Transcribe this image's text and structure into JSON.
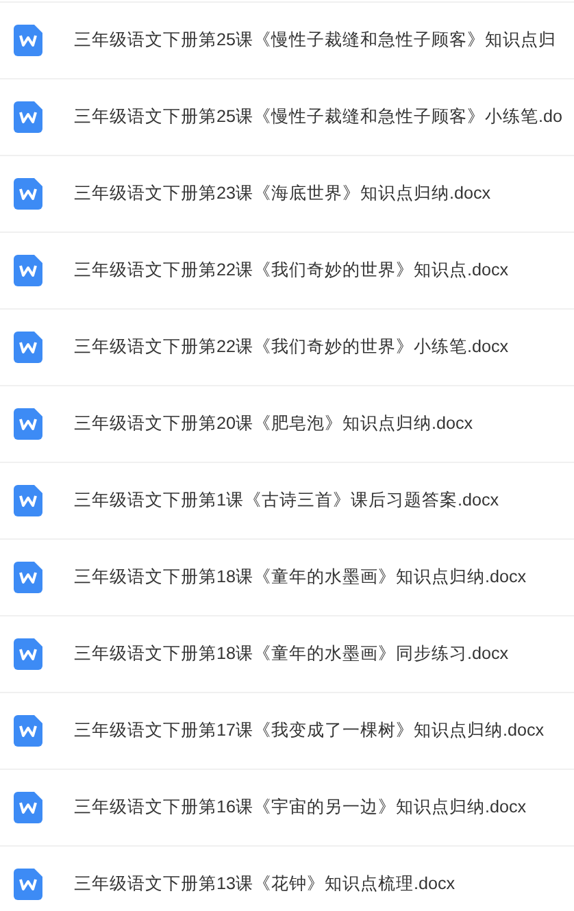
{
  "files": [
    {
      "name": "三年级语文下册第25课《慢性子裁缝和急性子顾客》知识点归"
    },
    {
      "name": "三年级语文下册第25课《慢性子裁缝和急性子顾客》小练笔.do"
    },
    {
      "name": "三年级语文下册第23课《海底世界》知识点归纳.docx"
    },
    {
      "name": "三年级语文下册第22课《我们奇妙的世界》知识点.docx"
    },
    {
      "name": "三年级语文下册第22课《我们奇妙的世界》小练笔.docx"
    },
    {
      "name": "三年级语文下册第20课《肥皂泡》知识点归纳.docx"
    },
    {
      "name": "三年级语文下册第1课《古诗三首》课后习题答案.docx"
    },
    {
      "name": "三年级语文下册第18课《童年的水墨画》知识点归纳.docx"
    },
    {
      "name": "三年级语文下册第18课《童年的水墨画》同步练习.docx"
    },
    {
      "name": "三年级语文下册第17课《我变成了一棵树》知识点归纳.docx"
    },
    {
      "name": "三年级语文下册第16课《宇宙的另一边》知识点归纳.docx"
    },
    {
      "name": "三年级语文下册第13课《花钟》知识点梳理.docx"
    }
  ]
}
